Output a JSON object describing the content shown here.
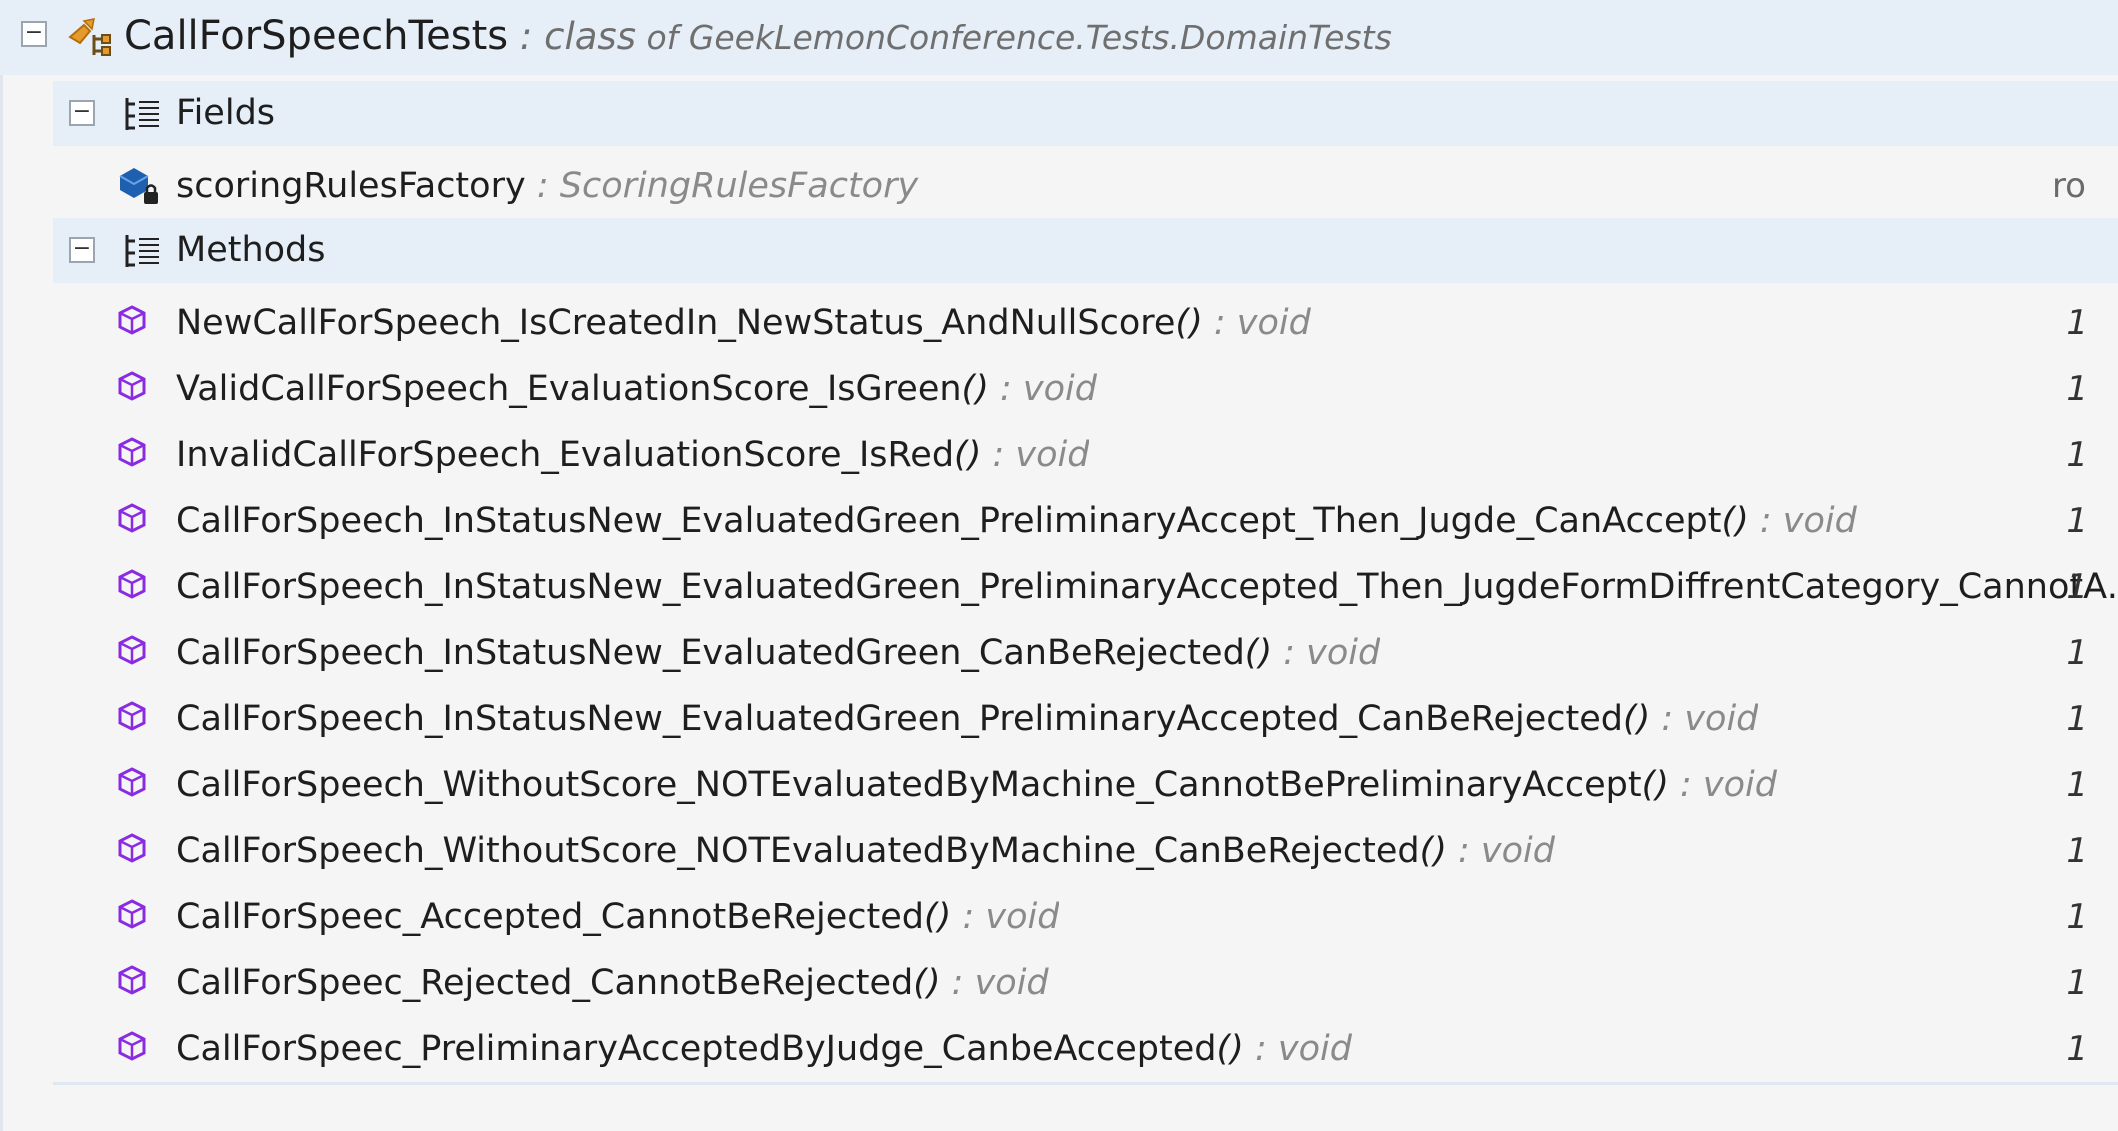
{
  "class_header": {
    "name": "CallForSpeechTests",
    "separator": " : ",
    "keyword": "class",
    "of_text": " of ",
    "namespace": "GeekLemonConference.Tests.DomainTests",
    "collapse_symbol": "−"
  },
  "fields_section": {
    "label": "Fields",
    "collapse_symbol": "−",
    "items": [
      {
        "name": "scoringRulesFactory",
        "separator": " : ",
        "type": "ScoringRulesFactory",
        "right": "ro"
      }
    ]
  },
  "methods_section": {
    "label": "Methods",
    "collapse_symbol": "−",
    "items": [
      {
        "name": "NewCallForSpeech_IsCreatedIn_NewStatus_AndNullScore",
        "parens": "()",
        "ret": " : void",
        "right": "1"
      },
      {
        "name": "ValidCallForSpeech_EvaluationScore_IsGreen",
        "parens": "()",
        "ret": " : void",
        "right": "1"
      },
      {
        "name": "InvalidCallForSpeech_EvaluationScore_IsRed",
        "parens": "()",
        "ret": " : void",
        "right": "1"
      },
      {
        "name": "CallForSpeech_InStatusNew_EvaluatedGreen_PreliminaryAccept_Then_Jugde_CanAccept",
        "parens": "()",
        "ret": " : void",
        "right": "1"
      },
      {
        "name": "CallForSpeech_InStatusNew_EvaluatedGreen_PreliminaryAccepted_Then_JugdeFormDiffrentCategory_CannotAccept...",
        "parens": "",
        "ret": "",
        "right": "1"
      },
      {
        "name": "CallForSpeech_InStatusNew_EvaluatedGreen_CanBeRejected",
        "parens": "()",
        "ret": " : void",
        "right": "1"
      },
      {
        "name": "CallForSpeech_InStatusNew_EvaluatedGreen_PreliminaryAccepted_CanBeRejected",
        "parens": "()",
        "ret": " : void",
        "right": "1"
      },
      {
        "name": "CallForSpeech_WithoutScore_NOTEvaluatedByMachine_CannotBePreliminaryAccept",
        "parens": "()",
        "ret": " : void",
        "right": "1"
      },
      {
        "name": "CallForSpeech_WithoutScore_NOTEvaluatedByMachine_CanBeRejected",
        "parens": "()",
        "ret": " : void",
        "right": "1"
      },
      {
        "name": "CallForSpeec_Accepted_CannotBeRejected",
        "parens": "()",
        "ret": " : void",
        "right": "1"
      },
      {
        "name": "CallForSpeec_Rejected_CannotBeRejected",
        "parens": "()",
        "ret": " : void",
        "right": "1"
      },
      {
        "name": "CallForSpeec_PreliminaryAcceptedByJudge_CanbeAccepted",
        "parens": "()",
        "ret": " : void",
        "right": "1"
      }
    ]
  },
  "icons": {
    "class": "class-icon",
    "section": "section-list-icon",
    "field": "private-field-icon",
    "method": "method-cube-icon"
  },
  "colors": {
    "header_bg": "#e6eef7",
    "method_icon": "#8a2be2",
    "field_icon": "#1f5fb0",
    "class_icon": "#e49b2c"
  }
}
